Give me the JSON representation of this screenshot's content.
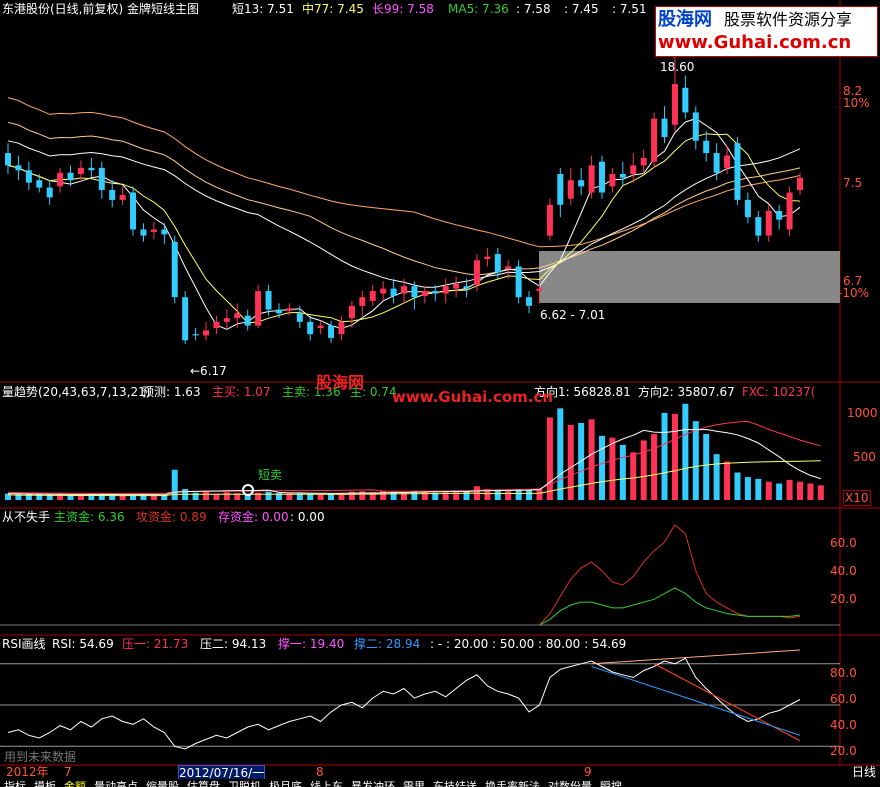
{
  "colors": {
    "bg": "#000000",
    "up": "#ff3355",
    "down": "#33ccff",
    "ma_short": "#ffffff",
    "ma_mid": "#ffff66",
    "ma_long": "#ffaa66",
    "ma5": "#ddddaa",
    "axis": "#aa0000",
    "zl_red": "#dd3322",
    "zl_green": "#33cc33",
    "rsi": "#ffffff",
    "press": "#ff4422",
    "support": "#3399ff"
  },
  "header": {
    "title": "东港股份(日线,前复权) 金牌短线主图",
    "short_label": "短13: 7.51",
    "mid_label": "中77: 7.45",
    "long_label": "长99: 7.58",
    "ma5_label": "MA5: 7.36",
    "v1": ": 7.58",
    "v2": ": 7.45",
    "v3": ": 7.51"
  },
  "watermark": {
    "logo_cn": "股海网",
    "logo_sub": "股票软件资源分享",
    "logo_url": "www.Guhai.com.cn",
    "mid_cn": "股海网",
    "mid_url": "www.Guhai.com.cn"
  },
  "main_axis": [
    "8.2",
    "10%",
    "7.5",
    "6.7",
    "-10%"
  ],
  "annotations": {
    "high": "18.60",
    "low": "←6.17",
    "range": "6.62 - 7.01"
  },
  "panel2": {
    "title": "量趋势(20,43,63,7,13,21)",
    "forecast": "预测: 1.63",
    "buy": "主买: 1.07",
    "sell": "主卖: 1.36",
    "hidden": "主: 0.74",
    "dir1": "方向1: 56828.81",
    "dir2": "方向2: 35807.67",
    "fxc": "FXC: 10237(",
    "axis": [
      "1000",
      "500"
    ],
    "unit": "X10",
    "signal": "短卖"
  },
  "panel3": {
    "title": "从不失手",
    "main": "主资金: 6.36",
    "attack": "攻资金: 0.89",
    "store": "存资金: 0.00",
    "extra": ": 0.00",
    "axis": [
      "60.0",
      "40.0",
      "20.0"
    ]
  },
  "panel4": {
    "title": "RSI画线",
    "rsi": "RSI: 54.69",
    "p1": "压一: 21.73",
    "p2": "压二: 94.13",
    "s1": "撑一: 19.40",
    "s2": "撑二: 28.94",
    "levels": ": - : 20.00 : 50.00 : 80.00 : 54.69",
    "axis": [
      "80.0",
      "60.0",
      "40.0",
      "20.0"
    ],
    "footer": "用到未来数据"
  },
  "dates": {
    "year": "2012年",
    "m7": "7",
    "cursor": "2012/07/16/一",
    "m8": "8",
    "m9": "9",
    "period": "日线"
  },
  "tabs": [
    "指标",
    "摸板",
    "金额",
    "量动高点",
    "缩量股",
    "估算盘",
    "卫脱机",
    "极月底",
    "线上车",
    "暴发冲环",
    "需里",
    "东技结送",
    "换手率新法",
    "对数份量",
    "瞬搜"
  ],
  "chart_data": {
    "type": "candlestick",
    "title": "东港股份(日线,前复权)",
    "price_range": [
      6.0,
      8.8
    ],
    "candles": [
      [
        7.72,
        7.62,
        7.8,
        7.55
      ],
      [
        7.62,
        7.58,
        7.7,
        7.5
      ],
      [
        7.58,
        7.48,
        7.65,
        7.42
      ],
      [
        7.5,
        7.44,
        7.55,
        7.4
      ],
      [
        7.44,
        7.36,
        7.5,
        7.3
      ],
      [
        7.45,
        7.56,
        7.6,
        7.4
      ],
      [
        7.56,
        7.5,
        7.62,
        7.45
      ],
      [
        7.55,
        7.6,
        7.66,
        7.5
      ],
      [
        7.6,
        7.58,
        7.68,
        7.52
      ],
      [
        7.6,
        7.42,
        7.65,
        7.35
      ],
      [
        7.42,
        7.34,
        7.5,
        7.28
      ],
      [
        7.34,
        7.38,
        7.45,
        7.3
      ],
      [
        7.4,
        7.1,
        7.45,
        7.05
      ],
      [
        7.1,
        7.05,
        7.15,
        7.0
      ],
      [
        7.08,
        7.1,
        7.16,
        7.02
      ],
      [
        7.1,
        7.06,
        7.15,
        6.98
      ],
      [
        7.0,
        6.55,
        7.05,
        6.5
      ],
      [
        6.55,
        6.2,
        6.6,
        6.17
      ],
      [
        6.25,
        6.24,
        6.3,
        6.2
      ],
      [
        6.24,
        6.28,
        6.35,
        6.2
      ],
      [
        6.3,
        6.35,
        6.4,
        6.25
      ],
      [
        6.35,
        6.38,
        6.45,
        6.3
      ],
      [
        6.38,
        6.42,
        6.5,
        6.3
      ],
      [
        6.4,
        6.32,
        6.45,
        6.28
      ],
      [
        6.32,
        6.6,
        6.65,
        6.3
      ],
      [
        6.6,
        6.45,
        6.65,
        6.4
      ],
      [
        6.45,
        6.42,
        6.5,
        6.38
      ],
      [
        6.44,
        6.46,
        6.5,
        6.4
      ],
      [
        6.42,
        6.35,
        6.48,
        6.3
      ],
      [
        6.35,
        6.25,
        6.4,
        6.2
      ],
      [
        6.3,
        6.32,
        6.36,
        6.25
      ],
      [
        6.32,
        6.22,
        6.36,
        6.18
      ],
      [
        6.25,
        6.35,
        6.4,
        6.2
      ],
      [
        6.38,
        6.48,
        6.52,
        6.3
      ],
      [
        6.48,
        6.55,
        6.6,
        6.4
      ],
      [
        6.52,
        6.6,
        6.65,
        6.48
      ],
      [
        6.58,
        6.62,
        6.68,
        6.52
      ],
      [
        6.62,
        6.56,
        6.7,
        6.5
      ],
      [
        6.58,
        6.64,
        6.7,
        6.5
      ],
      [
        6.64,
        6.55,
        6.68,
        6.45
      ],
      [
        6.56,
        6.6,
        6.64,
        6.5
      ],
      [
        6.6,
        6.58,
        6.65,
        6.52
      ],
      [
        6.58,
        6.64,
        6.7,
        6.5
      ],
      [
        6.62,
        6.66,
        6.72,
        6.55
      ],
      [
        6.64,
        6.62,
        6.7,
        6.55
      ],
      [
        6.65,
        6.85,
        6.9,
        6.6
      ],
      [
        6.86,
        6.88,
        6.95,
        6.8
      ],
      [
        6.9,
        6.75,
        6.95,
        6.7
      ],
      [
        6.78,
        6.8,
        6.85,
        6.7
      ],
      [
        6.8,
        6.55,
        6.85,
        6.5
      ],
      [
        6.55,
        6.48,
        6.6,
        6.42
      ],
      [
        6.6,
        6.62,
        6.66,
        6.5
      ],
      [
        7.05,
        7.3,
        7.35,
        7.01
      ],
      [
        7.55,
        7.3,
        7.6,
        7.2
      ],
      [
        7.35,
        7.5,
        7.6,
        7.3
      ],
      [
        7.5,
        7.45,
        7.6,
        7.38
      ],
      [
        7.4,
        7.62,
        7.7,
        7.35
      ],
      [
        7.65,
        7.4,
        7.7,
        7.35
      ],
      [
        7.45,
        7.55,
        7.6,
        7.4
      ],
      [
        7.55,
        7.52,
        7.65,
        7.45
      ],
      [
        7.55,
        7.62,
        7.72,
        7.48
      ],
      [
        7.62,
        7.68,
        7.75,
        7.55
      ],
      [
        7.65,
        8.0,
        8.05,
        7.6
      ],
      [
        8.0,
        7.85,
        8.1,
        7.8
      ],
      [
        7.95,
        8.28,
        8.6,
        7.9
      ],
      [
        8.25,
        8.05,
        8.35,
        8.0
      ],
      [
        8.05,
        7.82,
        8.1,
        7.75
      ],
      [
        7.82,
        7.72,
        7.9,
        7.65
      ],
      [
        7.72,
        7.56,
        7.8,
        7.5
      ],
      [
        7.6,
        7.7,
        7.78,
        7.55
      ],
      [
        7.8,
        7.34,
        7.85,
        7.3
      ],
      [
        7.34,
        7.2,
        7.4,
        7.15
      ],
      [
        7.2,
        7.05,
        7.25,
        7.0
      ],
      [
        7.05,
        7.25,
        7.3,
        7.0
      ],
      [
        7.25,
        7.18,
        7.3,
        7.1
      ],
      [
        7.1,
        7.4,
        7.45,
        7.05
      ],
      [
        7.42,
        7.52,
        7.56,
        7.38
      ]
    ],
    "series": [
      {
        "name": "短13",
        "values": [
          7.51
        ]
      },
      {
        "name": "中77",
        "values": [
          7.45
        ]
      },
      {
        "name": "长99",
        "values": [
          7.58
        ]
      },
      {
        "name": "MA5",
        "values": [
          7.36
        ]
      }
    ],
    "volume": [
      70,
      65,
      60,
      62,
      58,
      60,
      55,
      58,
      62,
      60,
      55,
      58,
      60,
      62,
      58,
      55,
      330,
      120,
      80,
      90,
      70,
      85,
      75,
      65,
      80,
      90,
      75,
      70,
      72,
      68,
      65,
      60,
      80,
      90,
      95,
      85,
      100,
      90,
      85,
      100,
      92,
      80,
      95,
      105,
      100,
      150,
      120,
      110,
      100,
      115,
      110,
      125,
      900,
      1000,
      820,
      840,
      880,
      700,
      680,
      600,
      520,
      650,
      720,
      950,
      940,
      1050,
      860,
      720,
      500,
      420,
      300,
      250,
      230,
      200,
      180,
      220,
      200,
      180,
      160
    ],
    "volume_range": [
      0,
      1200
    ],
    "rsi": [
      30,
      32,
      28,
      26,
      30,
      35,
      32,
      38,
      34,
      40,
      42,
      38,
      36,
      40,
      34,
      30,
      20,
      18,
      22,
      25,
      28,
      26,
      30,
      34,
      36,
      32,
      35,
      38,
      40,
      42,
      38,
      45,
      50,
      52,
      48,
      55,
      60,
      58,
      62,
      55,
      58,
      60,
      56,
      62,
      68,
      72,
      64,
      60,
      58,
      55,
      45,
      50,
      70,
      76,
      78,
      80,
      82,
      78,
      74,
      72,
      70,
      75,
      78,
      82,
      80,
      84,
      70,
      62,
      55,
      48,
      42,
      38,
      40,
      44,
      46,
      50,
      54
    ],
    "rsi_range": [
      10,
      90
    ],
    "zijin_red": [
      0,
      0,
      0,
      0,
      0,
      0,
      0,
      0,
      0,
      0,
      0,
      0,
      0,
      0,
      0,
      0,
      0,
      0,
      0,
      0,
      0,
      0,
      0,
      0,
      0,
      0,
      0,
      0,
      0,
      0,
      0,
      0,
      0,
      0,
      0,
      0,
      0,
      0,
      0,
      0,
      0,
      0,
      0,
      0,
      0,
      0,
      0,
      0,
      0,
      0,
      0,
      0,
      8,
      20,
      32,
      40,
      44,
      38,
      30,
      28,
      34,
      44,
      52,
      58,
      70,
      64,
      38,
      22,
      16,
      12,
      8,
      6,
      6,
      6,
      6,
      5,
      6
    ],
    "zijin_green": [
      0,
      0,
      0,
      0,
      0,
      0,
      0,
      0,
      0,
      0,
      0,
      0,
      0,
      0,
      0,
      0,
      0,
      0,
      0,
      0,
      0,
      0,
      0,
      0,
      0,
      0,
      0,
      0,
      0,
      0,
      0,
      0,
      0,
      0,
      0,
      0,
      0,
      0,
      0,
      0,
      0,
      0,
      0,
      0,
      0,
      0,
      0,
      0,
      0,
      0,
      0,
      0,
      4,
      10,
      14,
      16,
      16,
      14,
      12,
      12,
      14,
      16,
      18,
      22,
      26,
      22,
      16,
      12,
      10,
      8,
      7,
      6,
      6,
      6,
      6,
      6,
      7
    ],
    "zijin_range": [
      0,
      70
    ]
  }
}
